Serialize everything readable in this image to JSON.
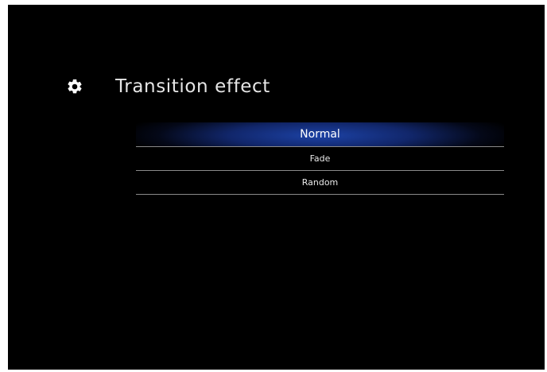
{
  "screen": {
    "title": "Transition effect",
    "title_icon": "gear-icon"
  },
  "menu": {
    "selected_index": 0,
    "items": [
      {
        "label": "Normal"
      },
      {
        "label": "Fade"
      },
      {
        "label": "Random"
      }
    ]
  },
  "colors": {
    "background": "#000000",
    "selection_highlight": "#1e46af",
    "text": "#e9e9e9"
  }
}
